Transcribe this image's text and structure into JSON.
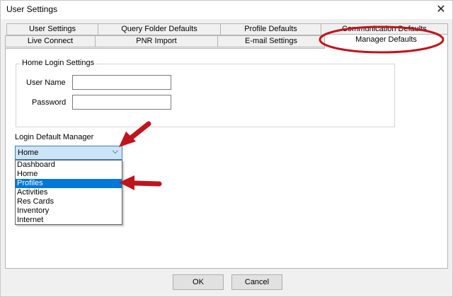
{
  "window": {
    "title": "User Settings",
    "close_glyph": "✕"
  },
  "tabs_row1": [
    {
      "label": "User Settings"
    },
    {
      "label": "Query Folder Defaults"
    },
    {
      "label": "Profile Defaults"
    },
    {
      "label": "Communication Defaults"
    }
  ],
  "tabs_row2": [
    {
      "label": "Live Connect"
    },
    {
      "label": "PNR Import"
    },
    {
      "label": "E-mail Settings"
    },
    {
      "label": "Manager Defaults",
      "active": true
    }
  ],
  "home_login": {
    "title": "Home Login Settings",
    "username_label": "User Name",
    "username_value": "",
    "password_label": "Password",
    "password_value": ""
  },
  "login_default": {
    "label": "Login Default Manager",
    "selected": "Home",
    "arrow_glyph": "⌵",
    "options": [
      "Dashboard",
      "Home",
      "Profiles",
      "Activities",
      "Res Cards",
      "Inventory",
      "Internet"
    ],
    "highlighted": "Profiles"
  },
  "buttons": {
    "ok": "OK",
    "cancel": "Cancel"
  },
  "annotation": {
    "color": "#c0141c"
  }
}
